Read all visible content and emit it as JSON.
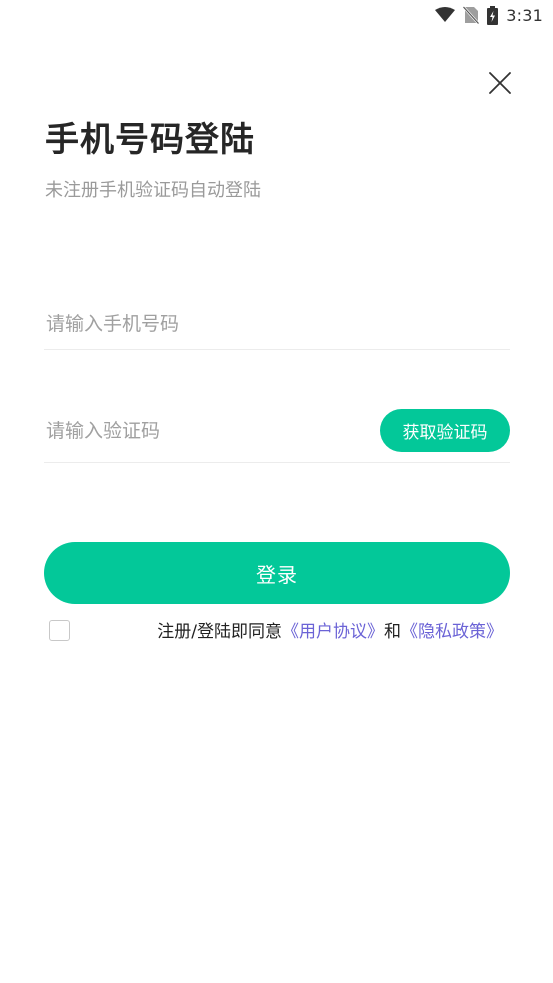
{
  "status_bar": {
    "time": "3:31",
    "icons": [
      "wifi-icon",
      "no-sim-icon",
      "battery-charging-icon"
    ]
  },
  "header": {
    "close_icon": "close-icon",
    "title": "手机号码登陆",
    "subtitle": "未注册手机验证码自动登陆"
  },
  "form": {
    "phone_placeholder": "请输入手机号码",
    "phone_value": "",
    "code_placeholder": "请输入验证码",
    "code_value": "",
    "send_code_label": "获取验证码",
    "login_label": "登录"
  },
  "agreement": {
    "checked": false,
    "prefix": "注册/登陆即同意",
    "user_agreement": "《用户协议》",
    "conjunction": "和",
    "privacy_policy": "《隐私政策》"
  },
  "colors": {
    "accent": "#03c899",
    "link": "#6b63d6",
    "title": "#262626",
    "subtitle": "#9a9a9a"
  }
}
